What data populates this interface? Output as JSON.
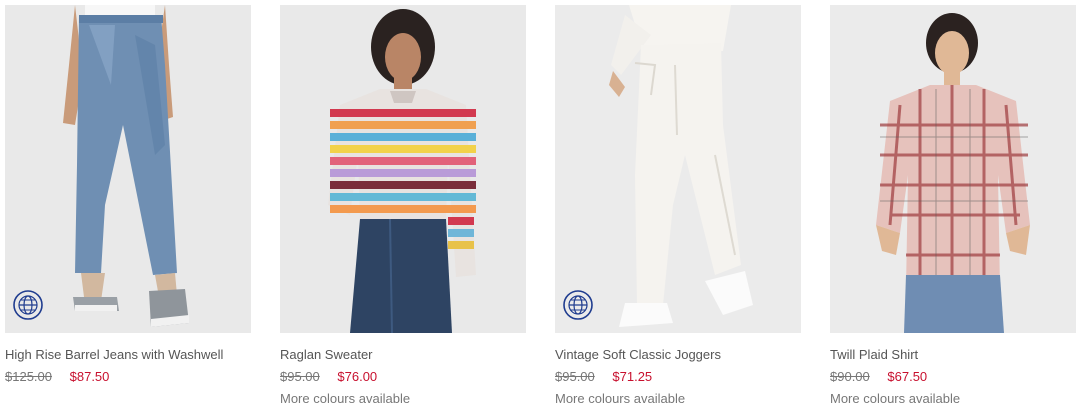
{
  "products": [
    {
      "name": "High Rise Barrel Jeans with Washwell",
      "original_price": "$125.00",
      "sale_price": "$87.50",
      "more_colours": "",
      "sustainability_badge": "globe-icon"
    },
    {
      "name": "Raglan Sweater",
      "original_price": "$95.00",
      "sale_price": "$76.00",
      "more_colours": "More colours available",
      "sustainability_badge": ""
    },
    {
      "name": "Vintage Soft Classic Joggers",
      "original_price": "$95.00",
      "sale_price": "$71.25",
      "more_colours": "More colours available",
      "sustainability_badge": "globe-icon"
    },
    {
      "name": "Twill Plaid Shirt",
      "original_price": "$90.00",
      "sale_price": "$67.50",
      "more_colours": "More colours available",
      "sustainability_badge": ""
    }
  ],
  "colors": {
    "sale_price": "#c8102e",
    "badge": "#1f3c8f",
    "image_bg": "#ececec"
  }
}
